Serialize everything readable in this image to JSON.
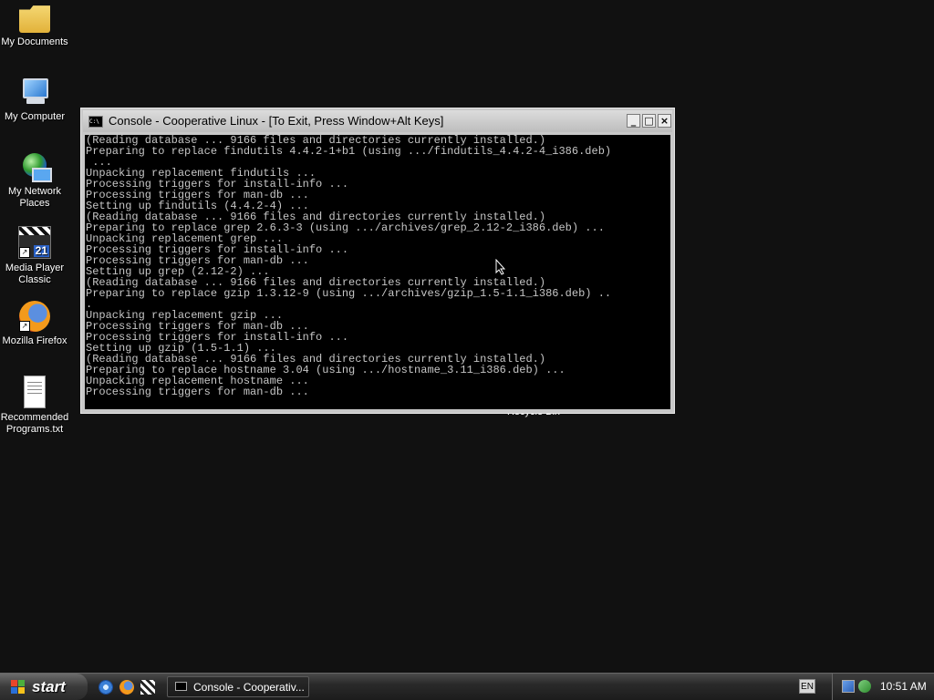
{
  "desktop": {
    "icons": [
      {
        "label": "My Documents"
      },
      {
        "label": "My Computer"
      },
      {
        "label": "My Network Places"
      },
      {
        "label": "Media Player Classic",
        "badge": "21"
      },
      {
        "label": "Mozilla Firefox"
      },
      {
        "label": "Recommended Programs.txt"
      }
    ],
    "recycle_bin_label": "Recycle Bin"
  },
  "console": {
    "title": "Console - Cooperative Linux - [To Exit, Press Window+Alt Keys]",
    "icon_text": "C:\\",
    "minimize": "_",
    "maximize": "□",
    "close": "×",
    "lines": [
      "(Reading database ... 9166 files and directories currently installed.)",
      "Preparing to replace findutils 4.4.2-1+b1 (using .../findutils_4.4.2-4_i386.deb)",
      " ...",
      "Unpacking replacement findutils ...",
      "Processing triggers for install-info ...",
      "Processing triggers for man-db ...",
      "Setting up findutils (4.4.2-4) ...",
      "(Reading database ... 9166 files and directories currently installed.)",
      "Preparing to replace grep 2.6.3-3 (using .../archives/grep_2.12-2_i386.deb) ...",
      "Unpacking replacement grep ...",
      "Processing triggers for install-info ...",
      "Processing triggers for man-db ...",
      "Setting up grep (2.12-2) ...",
      "(Reading database ... 9166 files and directories currently installed.)",
      "Preparing to replace gzip 1.3.12-9 (using .../archives/gzip_1.5-1.1_i386.deb) ..",
      ".",
      "Unpacking replacement gzip ...",
      "Processing triggers for man-db ...",
      "Processing triggers for install-info ...",
      "Setting up gzip (1.5-1.1) ...",
      "(Reading database ... 9166 files and directories currently installed.)",
      "Preparing to replace hostname 3.04 (using .../hostname_3.11_i386.deb) ...",
      "Unpacking replacement hostname ...",
      "Processing triggers for man-db ..."
    ]
  },
  "taskbar": {
    "start_label": "start",
    "task_console_label": "Console - Cooperativ...",
    "language": "EN",
    "clock": "10:51 AM"
  }
}
